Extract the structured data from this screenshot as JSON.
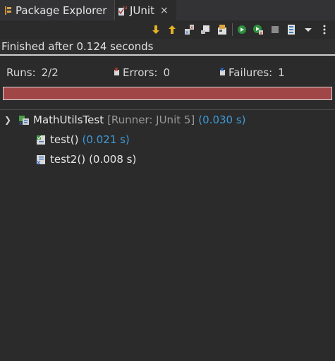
{
  "tabs": {
    "package_explorer": "Package Explorer",
    "junit": "JUnit",
    "close_glyph": "×"
  },
  "toolbar": {
    "icons": [
      "next-failure-icon",
      "previous-failure-icon",
      "show-failures-only-icon",
      "scroll-lock-icon",
      "history-icon",
      "rerun-icon",
      "rerun-failed-first-icon",
      "stop-icon",
      "layout-icon",
      "view-menu-icon",
      "more-icon"
    ]
  },
  "status": {
    "text": "Finished after 0.124 seconds"
  },
  "counters": {
    "runs_label": "Runs:",
    "runs_value": "2/2",
    "errors_label": "Errors:",
    "errors_value": "0",
    "failures_label": "Failures:",
    "failures_value": "1"
  },
  "progress": {
    "fraction": 1.0,
    "color": "#a04646"
  },
  "tree": {
    "root": {
      "name": "MathUtilsTest",
      "runner": "[Runner: JUnit 5]",
      "time": "(0.030 s)"
    },
    "children": [
      {
        "name": "test()",
        "time": "(0.021 s)"
      },
      {
        "name": "test2()",
        "time": "(0.008 s)"
      }
    ]
  },
  "colors": {
    "accent_blue": "#3f9ad6",
    "failure_red": "#a04646",
    "background": "#2b2b2b"
  }
}
